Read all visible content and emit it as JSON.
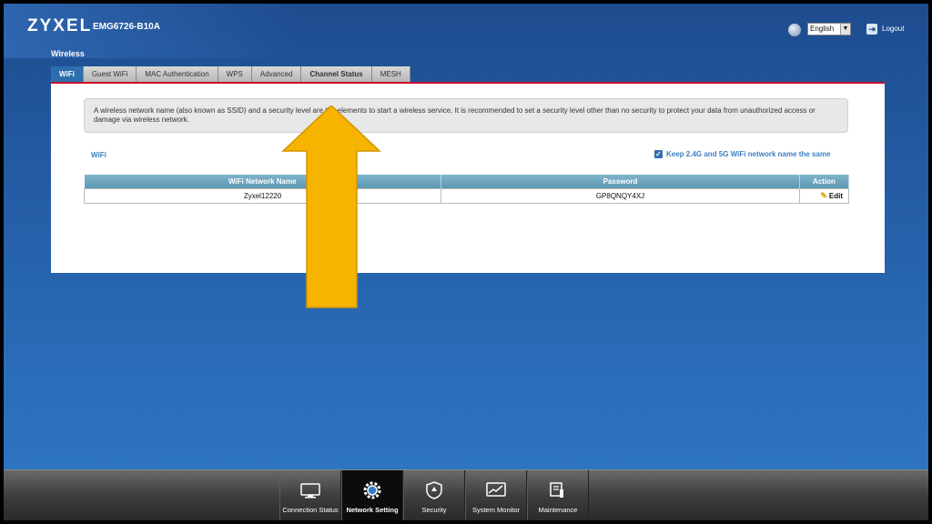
{
  "header": {
    "brand": "ZYXEL",
    "model": "EMG6726-B10A",
    "language": "English",
    "logout_label": "Logout"
  },
  "section_title": "Wireless",
  "tabs": [
    {
      "label": "WiFi",
      "active": true
    },
    {
      "label": "Guest WiFi"
    },
    {
      "label": "MAC Authentication"
    },
    {
      "label": "WPS"
    },
    {
      "label": "Advanced"
    },
    {
      "label": "Channel Status"
    },
    {
      "label": "MESH"
    }
  ],
  "notice": "A wireless network name (also known as SSID) and a security level are the elements to start a wireless service. It is recommended to set a security level other than no security to protect your data from unauthorized access or damage via wireless network.",
  "wifi_label": "WiFi",
  "keep_same_label": "Keep 2.4G and 5G WiFi network name the same",
  "keep_same_checked": true,
  "table": {
    "headers": [
      "WiFi Network Name",
      "Password",
      "Action"
    ],
    "rows": [
      {
        "name": "Zyxel12220",
        "password": "GP8QNQY4XJ",
        "action": "Edit"
      }
    ]
  },
  "nav": [
    {
      "label": "Connection Status",
      "icon": "monitor-icon"
    },
    {
      "label": "Network Setting",
      "icon": "gear-icon",
      "active": true
    },
    {
      "label": "Security",
      "icon": "shield-icon"
    },
    {
      "label": "System Monitor",
      "icon": "chart-monitor-icon"
    },
    {
      "label": "Maintenance",
      "icon": "wrench-icon"
    }
  ],
  "colors": {
    "background_top": "#1d4c8e",
    "background_bottom": "#2f78c6",
    "accent_tab": "#2d6fae",
    "red_rule": "#c8102e",
    "arrow_fill": "#f6b400",
    "link_blue": "#3c7fc2"
  }
}
